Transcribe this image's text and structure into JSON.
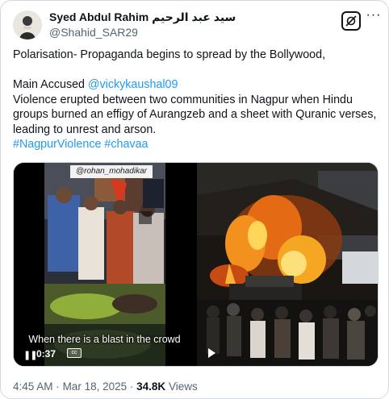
{
  "author": {
    "display_name": "Syed Abdul Rahim سيد عبد الرحيم",
    "handle": "@Shahid_SAR29"
  },
  "tweet": {
    "line1": "Polarisation- Propaganda begins to spread by the Bollywood,",
    "accused_prefix": "Main Accused ",
    "accused_mention": "@vickykaushal09",
    "body_line1": "Violence erupted between two communities in Nagpur when Hindu",
    "body_line2": "groups burned an effigy of Aurangzeb and a sheet with Quranic verses,",
    "body_line3": "leading to unrest and arson.",
    "hashtag1": "#NagpurViolence",
    "hashtag2": "#chavaa"
  },
  "media": {
    "left_video": {
      "watermark": "@rohan_mohadikar",
      "caption": "When there is a blast in the crowd",
      "time": "0:37",
      "cc_label": "cc"
    }
  },
  "footer": {
    "time": "4:45 AM",
    "separator": "·",
    "date": "Mar 18, 2025",
    "views_count": "34.8K",
    "views_label": "Views"
  },
  "icons": {
    "avatar": "avatar",
    "grok": "grok-icon",
    "more": "more-icon",
    "pause": "pause-icon",
    "play": "play-icon"
  },
  "colors": {
    "link": "#1d9bf0",
    "text": "#0f1419",
    "secondary": "#536471",
    "border": "#cfd9de"
  }
}
